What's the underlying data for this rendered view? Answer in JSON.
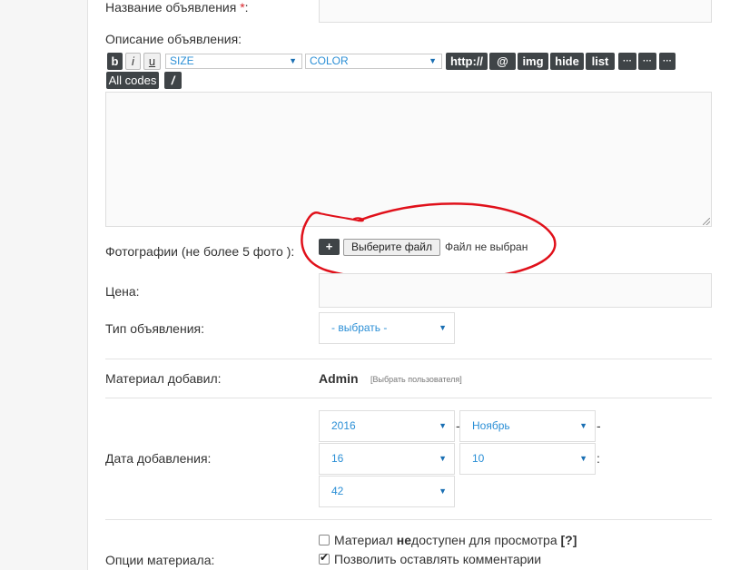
{
  "form": {
    "title_label": "Название объявления ",
    "required_mark": "*",
    "title_colon": ":",
    "description_label": "Описание объявления:",
    "photos_label": "Фотографии (не более 5 фото ):",
    "price_label": "Цена:",
    "type_label": "Тип объявления:",
    "added_by_label": "Материал добавил:",
    "date_label": "Дата добавления:",
    "options_label": "Опции материала:"
  },
  "toolbar": {
    "bold": "b",
    "italic": "i",
    "underline": "u",
    "size_select": "SIZE",
    "color_select": "COLOR",
    "url": "http://",
    "email": "@",
    "img": "img",
    "hide": "hide",
    "list": "list",
    "more1": "···",
    "more2": "···",
    "more3": "···",
    "all_codes": "All codes",
    "slash": "/"
  },
  "upload": {
    "add": "+",
    "choose_file": "Выберите файл",
    "status": "Файл не выбран"
  },
  "type_select": {
    "value": "- выбрать -"
  },
  "added_by": {
    "user": "Admin",
    "pick_user": "[Выбрать пользователя]"
  },
  "date": {
    "year": "2016",
    "month": "Ноябрь",
    "day": "16",
    "hour": "10",
    "minute": "42",
    "dash1": "-",
    "dash2": "-",
    "colon": ":"
  },
  "options": {
    "unavailable": {
      "checked": false,
      "pre": "Материал ",
      "bold": "не",
      "post": "доступен для просмотра ",
      "help": "[?]"
    },
    "comments": {
      "checked": true,
      "text": "Позволить оставлять комментарии"
    }
  },
  "colors": {
    "annotation": "#e0101a",
    "select_text": "#2b8fd6",
    "button_dark": "#3f4447",
    "required": "#d9262c"
  }
}
